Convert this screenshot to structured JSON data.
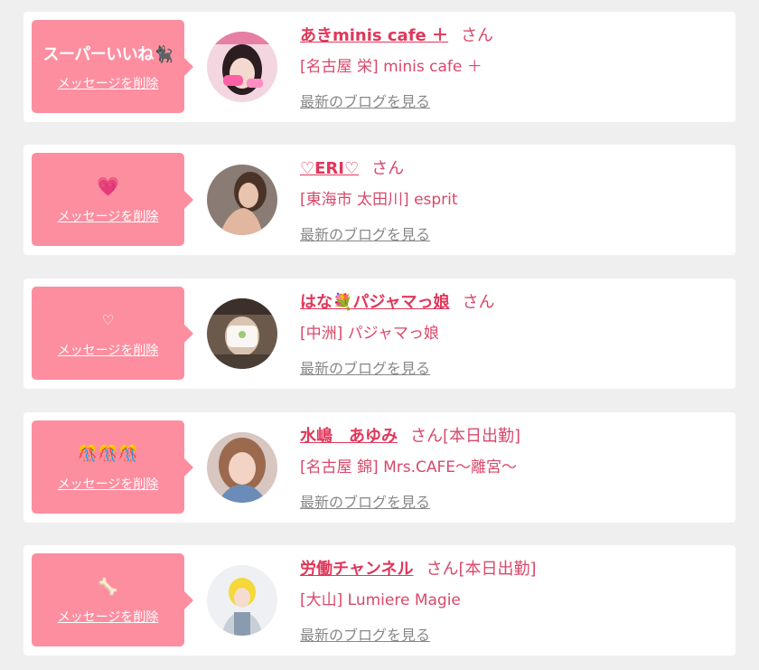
{
  "entries": [
    {
      "message": "スーパーいいね🐈‍⬛",
      "message_type": "text",
      "delete_label": "メッセージを削除",
      "name": "あきminis cafe ＋",
      "honorific": "さん",
      "shop": "[名古屋 栄] minis cafe ＋",
      "blog_link": "最新のブログを見る",
      "avatar_icon": "profile-photo"
    },
    {
      "message": "💗",
      "message_type": "emoji",
      "delete_label": "メッセージを削除",
      "name": "♡ERI♡",
      "honorific": "さん",
      "shop": "[東海市 太田川] esprit",
      "blog_link": "最新のブログを見る",
      "avatar_icon": "profile-photo"
    },
    {
      "message": "♡",
      "message_type": "emoji",
      "delete_label": "メッセージを削除",
      "name": "はな💐パジャマっ娘",
      "honorific": "さん",
      "shop": "[中洲] パジャマっ娘",
      "blog_link": "最新のブログを見る",
      "avatar_icon": "profile-photo"
    },
    {
      "message": "🎊🎊🎊",
      "message_type": "emoji",
      "delete_label": "メッセージを削除",
      "name": "水嶋　あゆみ",
      "honorific": "さん[本日出勤]",
      "shop": "[名古屋 錦] Mrs.CAFE～離宮～",
      "blog_link": "最新のブログを見る",
      "avatar_icon": "profile-photo"
    },
    {
      "message": "🦴",
      "message_type": "emoji",
      "delete_label": "メッセージを削除",
      "name": "労働チャンネル",
      "honorific": "さん[本日出勤]",
      "shop": "[大山] Lumiere Magie",
      "blog_link": "最新のブログを見る",
      "avatar_icon": "profile-photo"
    }
  ],
  "colors": {
    "bubble": "#fd8ea0",
    "name": "#e0375b",
    "text_pink": "#d9486a",
    "link_gray": "#888888",
    "background": "#efefef"
  }
}
